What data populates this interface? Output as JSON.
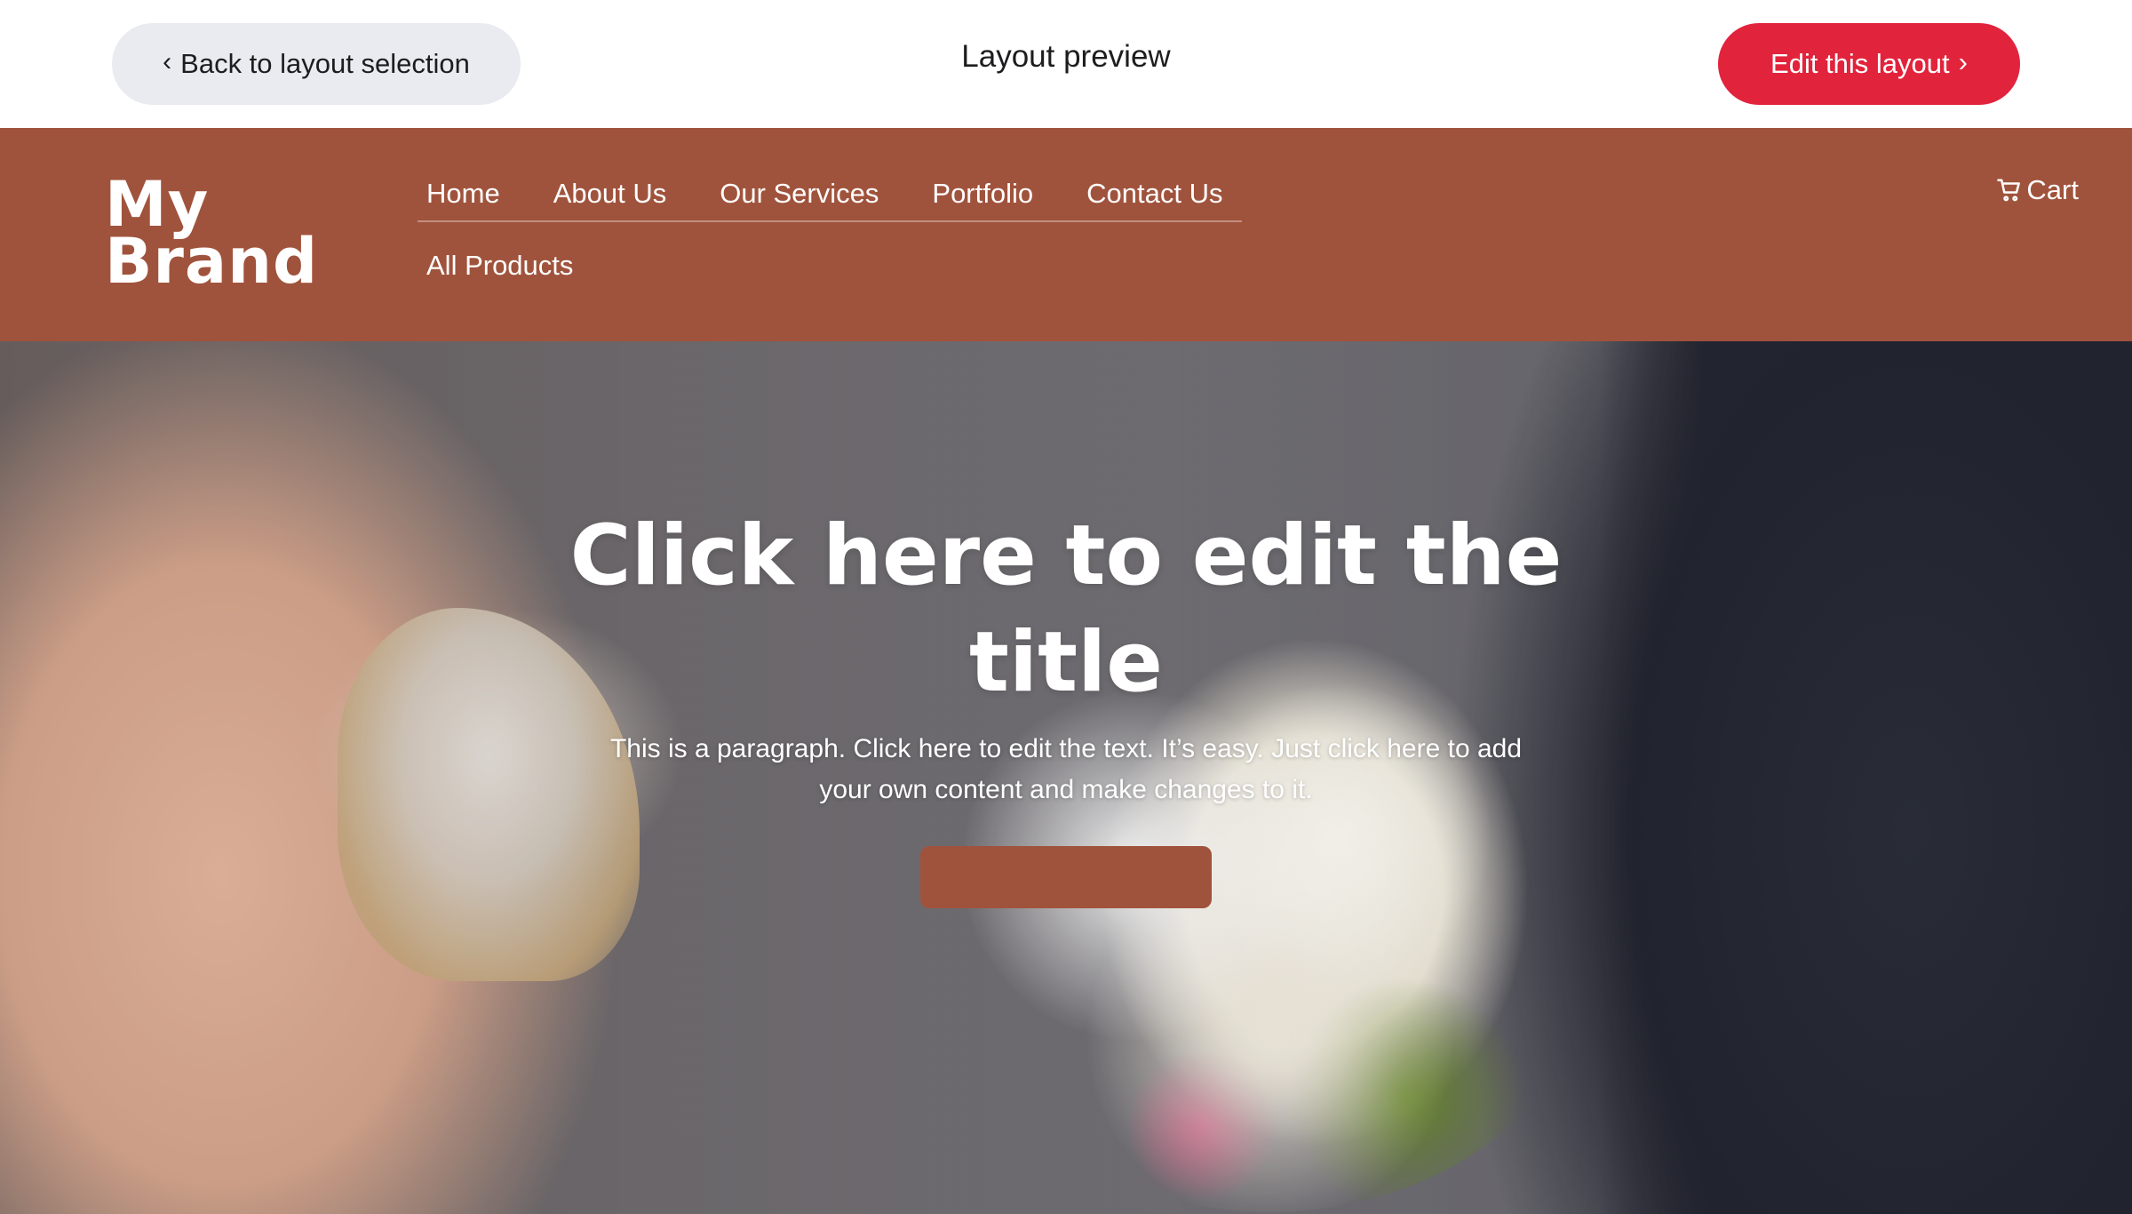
{
  "topbar": {
    "back_label": "Back to layout selection",
    "title": "Layout preview",
    "edit_label": "Edit this layout"
  },
  "site": {
    "logo_line1": "My",
    "logo_line2": "Brand",
    "nav": [
      "Home",
      "About Us",
      "Our Services",
      "Portfolio",
      "Contact Us"
    ],
    "nav_second_row": "All Products",
    "cart_label": "Cart"
  },
  "hero": {
    "title": "Click here to edit the title",
    "paragraph": "This is a paragraph. Click here to edit the text. It’s easy. Just click here to add your own content and make changes to it."
  },
  "colors": {
    "accent": "#e2233c",
    "brand": "#a0533c"
  },
  "icons": {
    "back": "chevron-left-icon",
    "edit": "chevron-right-icon",
    "cart": "cart-icon"
  }
}
